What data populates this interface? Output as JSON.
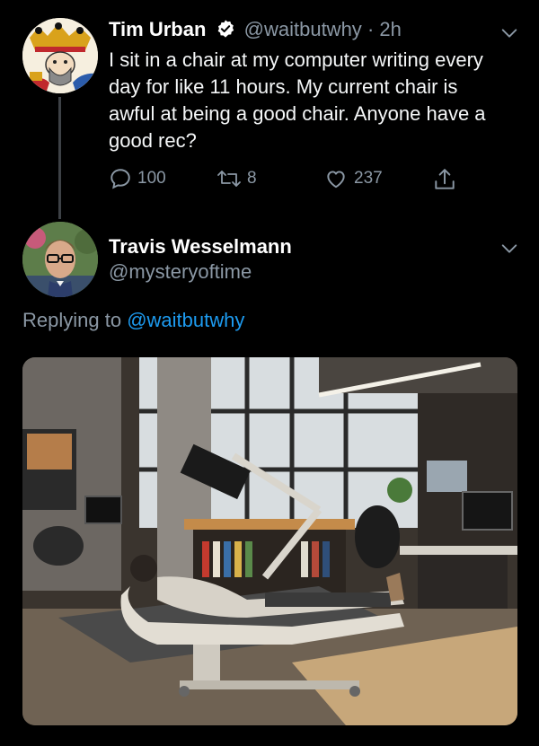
{
  "tweet": {
    "author_name": "Tim Urban",
    "author_handle": "@waitbutwhy",
    "separator": "·",
    "time": "2h",
    "text": "I sit in a chair at my computer writing every day for like 11 hours. My current chair is awful at being a good chair. Anyone have a good rec?",
    "replies": "100",
    "retweets": "8",
    "likes": "237"
  },
  "reply": {
    "author_name": "Travis Wesselmann",
    "author_handle": "@mysteryoftime",
    "replying_prefix": "Replying to",
    "replying_to": "@waitbutwhy"
  },
  "colors": {
    "background": "#000000",
    "secondary_text": "#8b98a5",
    "link": "#1d9bf0",
    "primary_text": "#ffffff"
  },
  "icons": {
    "verified": "verified-badge-icon",
    "reply": "reply-icon",
    "retweet": "retweet-icon",
    "like": "heart-icon",
    "share": "share-icon",
    "more": "chevron-down-icon"
  }
}
